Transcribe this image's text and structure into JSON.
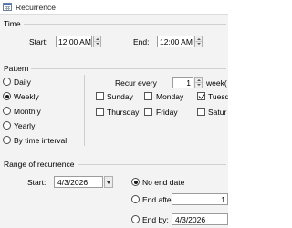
{
  "window": {
    "title": "Recurrence"
  },
  "time": {
    "group_title": "Time",
    "start_label": "Start:",
    "start_value": "12:00 AM",
    "end_label": "End:",
    "end_value": "12:00 AM"
  },
  "pattern": {
    "group_title": "Pattern",
    "options": [
      {
        "label": "Daily",
        "checked": false
      },
      {
        "label": "Weekly",
        "checked": true
      },
      {
        "label": "Monthly",
        "checked": false
      },
      {
        "label": "Yearly",
        "checked": false
      },
      {
        "label": "By time interval",
        "checked": false
      }
    ],
    "recur_every_label": "Recur every",
    "recur_every_value": "1",
    "recur_unit_label": "week(",
    "days": [
      {
        "label": "Sunday",
        "checked": false
      },
      {
        "label": "Monday",
        "checked": false
      },
      {
        "label": "Tuesd",
        "checked": true
      },
      {
        "label": "Thursday",
        "checked": false
      },
      {
        "label": "Friday",
        "checked": false
      },
      {
        "label": "Satur",
        "checked": false
      }
    ]
  },
  "range": {
    "group_title": "Range of recurrence",
    "start_label": "Start:",
    "start_value": "4/3/2026",
    "no_end_label": "No end date",
    "no_end_checked": true,
    "end_after_label": "End after:",
    "end_after_value": "1",
    "end_by_label": "End by:",
    "end_by_value": "4/3/2026"
  }
}
